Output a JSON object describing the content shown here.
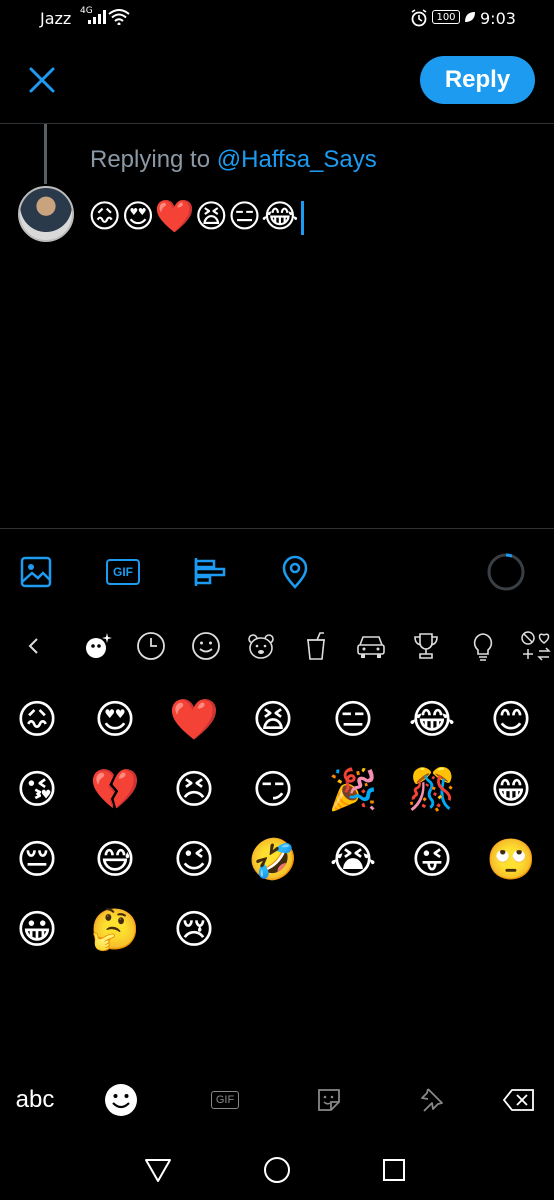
{
  "status": {
    "carrier": "Jazz",
    "network": "4G",
    "battery": "100",
    "time": "9:03"
  },
  "header": {
    "reply_label": "Reply"
  },
  "compose": {
    "replying_prefix": "Replying to",
    "replying_handle": "@Haffsa_Says",
    "text": "😖😍❤️😫😑😂"
  },
  "toolbar": {
    "gif_label": "GIF"
  },
  "emoji_rows": [
    [
      "😖",
      "😍",
      "❤️",
      "😫",
      "😑",
      "😂",
      "😊"
    ],
    [
      "😘",
      "💔",
      "😣",
      "😏",
      "🎉",
      "🎊",
      "😁"
    ],
    [
      "😔",
      "😅",
      "😉",
      "🤣",
      "😭",
      "😜",
      "🙄"
    ],
    [
      "😀",
      "🤔",
      "😢"
    ]
  ],
  "keyboard": {
    "abc_label": "abc",
    "gif_label": "GIF"
  },
  "colors": {
    "accent": "#1d9bf0",
    "background": "#000000",
    "muted": "#8b98a5"
  }
}
